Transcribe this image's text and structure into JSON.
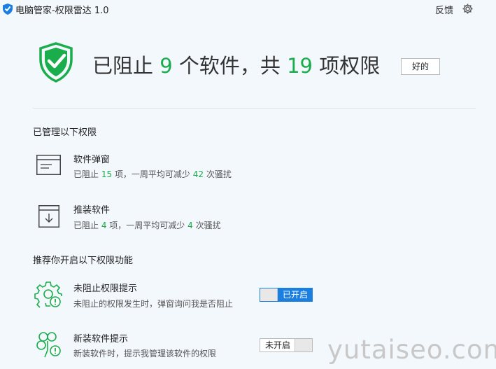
{
  "window": {
    "title": "电脑管家-权限雷达 1.0",
    "feedback_label": "反馈"
  },
  "summary": {
    "part1": "已阻止 ",
    "blocked_count": "9",
    "part2": " 个软件，共 ",
    "permission_count": "19",
    "part3": " 项权限",
    "ok_label": "好的"
  },
  "managed": {
    "title": "已管理以下权限",
    "items": [
      {
        "title": "软件弹窗",
        "desc_a": "已阻止 ",
        "count": "15",
        "desc_b": " 项，一周平均可减少 ",
        "reduce": "42",
        "desc_c": " 次骚扰"
      },
      {
        "title": "推装软件",
        "desc_a": "已阻止 ",
        "count": "4",
        "desc_b": " 项，一周平均可减少 ",
        "reduce": "4",
        "desc_c": " 次骚扰"
      }
    ]
  },
  "recommend": {
    "title": "推荐你开启以下权限功能",
    "items": [
      {
        "title": "未阻止权限提示",
        "desc": "未阻止的权限发生时，弹窗询问我是否阻止",
        "toggle_label": "已开启",
        "enabled": true
      },
      {
        "title": "新装软件提示",
        "desc": "新装软件时，提示我管理该软件的权限",
        "toggle_label": "未开启",
        "enabled": false
      }
    ]
  },
  "watermark": "yutaiseo.com",
  "colors": {
    "accent_green": "#1aad4b",
    "toggle_blue": "#1a7fe0",
    "background": "#f3f8fd"
  }
}
